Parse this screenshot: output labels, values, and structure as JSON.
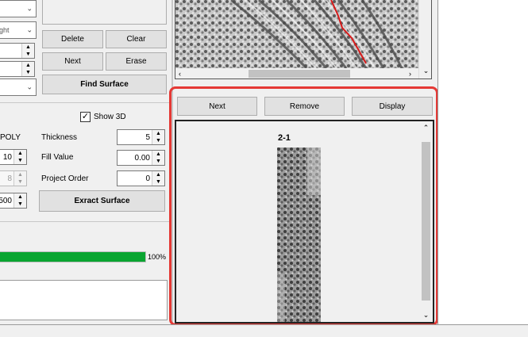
{
  "left_panel": {
    "top_combo_1": {
      "value": ""
    },
    "top_combo_2": {
      "value": "ght"
    },
    "buttons": {
      "delete": "Delete",
      "clear": "Clear",
      "next": "Next",
      "erase": "Erase",
      "find_surface": "Find Surface"
    }
  },
  "extract": {
    "show3d_label": "Show 3D",
    "show3d_checked": true,
    "poly_label": "POLY",
    "thickness_label": "Thickness",
    "thickness_value": "5",
    "fill_value_label": "Fill Value",
    "fill_value": "0.00",
    "project_order_label": "Project Order",
    "project_order_value": "0",
    "left_field_1": "10",
    "left_field_2": "8",
    "left_field_3": "500",
    "extract_button": "Exract Surface"
  },
  "progress": {
    "percent": 100,
    "label": "100%",
    "color": "#0aa531"
  },
  "right_panel": {
    "buttons": {
      "next": "Next",
      "remove": "Remove",
      "display": "Display"
    },
    "slice_title": "2-1"
  },
  "colors": {
    "highlight": "#e53935",
    "trace": "#d81b1b"
  }
}
